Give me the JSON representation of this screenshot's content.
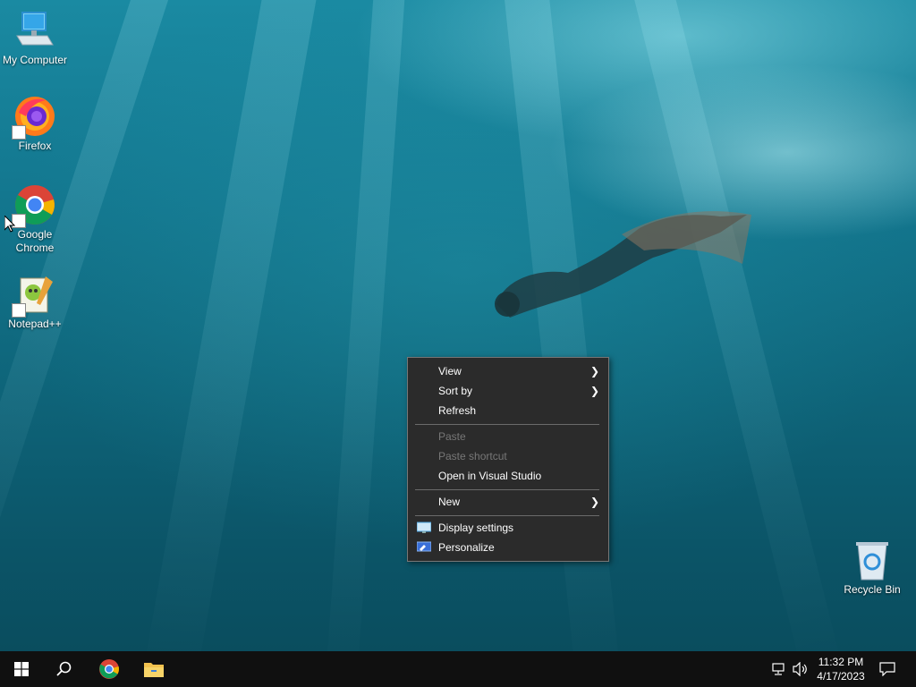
{
  "desktop": {
    "icons": [
      {
        "label": "My Computer",
        "icon": "computer-icon"
      },
      {
        "label": "Firefox",
        "icon": "firefox-icon"
      },
      {
        "label": "Google Chrome",
        "icon": "chrome-icon"
      },
      {
        "label": "Notepad++",
        "icon": "notepadpp-icon"
      },
      {
        "label": "Recycle Bin",
        "icon": "recycle-bin-icon"
      }
    ]
  },
  "context_menu": {
    "items": [
      {
        "label": "View",
        "submenu": true,
        "enabled": true
      },
      {
        "label": "Sort by",
        "submenu": true,
        "enabled": true
      },
      {
        "label": "Refresh",
        "submenu": false,
        "enabled": true
      },
      {
        "label": "Paste",
        "submenu": false,
        "enabled": false
      },
      {
        "label": "Paste shortcut",
        "submenu": false,
        "enabled": false
      },
      {
        "label": "Open in Visual Studio",
        "submenu": false,
        "enabled": true
      },
      {
        "label": "New",
        "submenu": true,
        "enabled": true
      },
      {
        "label": "Display settings",
        "submenu": false,
        "enabled": true,
        "icon": "display-icon"
      },
      {
        "label": "Personalize",
        "submenu": false,
        "enabled": true,
        "icon": "personalize-icon"
      }
    ]
  },
  "taskbar": {
    "clock_time": "11:32 PM",
    "clock_date": "4/17/2023",
    "pinned": [
      "start-icon",
      "search-icon",
      "chrome-icon",
      "file-explorer-icon"
    ],
    "tray": [
      "network-icon",
      "volume-icon",
      "notifications-icon"
    ]
  },
  "colors": {
    "menu_bg": "#2b2b2b",
    "taskbar_bg": "#101010",
    "start_blue": "#ffffff"
  }
}
